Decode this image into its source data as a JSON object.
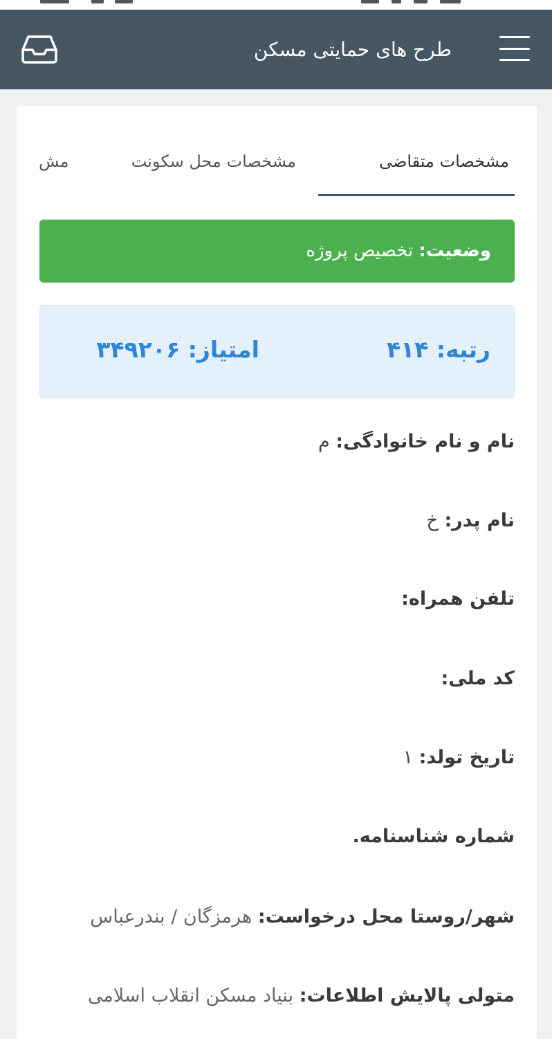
{
  "app": {
    "title": "طرح های حمایتی مسکن",
    "colors": {
      "appbar": "#465662",
      "status_green": "#4cb050",
      "score_blue": "#2f86d6",
      "score_bg": "#e4f1fc"
    },
    "icons": {
      "menu": "hamburger-menu-icon",
      "inbox": "inbox-tray-icon"
    }
  },
  "tabs": [
    {
      "label": "مشخصات متقاضی",
      "active": true
    },
    {
      "label": "مشخصات محل سکونت",
      "active": false
    },
    {
      "label": "مش",
      "active": false
    }
  ],
  "status": {
    "label": "وضعیت:",
    "value": "تخصیص پروژه"
  },
  "score": {
    "rank_label": "رتبه:",
    "rank_value": "۴۱۴",
    "points_label": "امتیاز:",
    "points_value": "۳۴۹۲۰۶"
  },
  "fields": [
    {
      "label": "نام و نام خانوادگی:",
      "value": "م"
    },
    {
      "label": "نام پدر:",
      "value": "خ"
    },
    {
      "label": "تلفن همراه:",
      "value": ""
    },
    {
      "label": "کد ملی:",
      "value": ""
    },
    {
      "label": "تاریخ تولد:",
      "value": "۱"
    },
    {
      "label": "شماره شناسنامه.",
      "value": ""
    },
    {
      "label": "شهر/روستا محل درخواست:",
      "value": "هرمزگان / بندرعباس"
    },
    {
      "label": "متولی پالایش اطلاعات:",
      "value": "بنیاد مسکن انقلاب اسلامی"
    }
  ]
}
